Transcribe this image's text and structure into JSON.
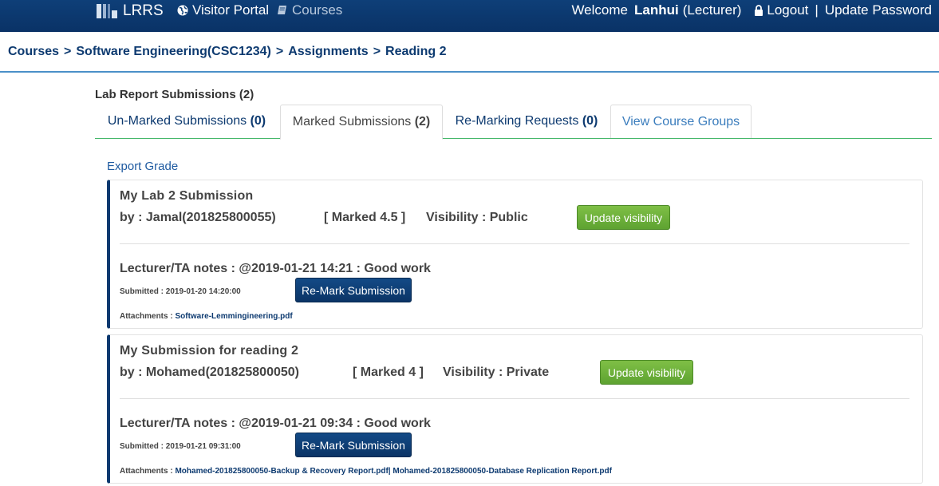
{
  "nav": {
    "brand": "LRRS",
    "visitor_portal": "Visitor Portal",
    "courses": "Courses",
    "welcome": "Welcome",
    "user_name": "Lanhui",
    "user_role": "(Lecturer)",
    "logout": "Logout",
    "separator": "|",
    "update_password": "Update Password"
  },
  "breadcrumb": {
    "items": [
      "Courses",
      "Software Engineering(CSC1234)",
      "Assignments",
      "Reading 2"
    ],
    "separator": ">"
  },
  "section_title": "Lab Report Submissions (2)",
  "tabs": [
    {
      "label": "Un-Marked Submissions",
      "count": "(0)"
    },
    {
      "label": "Marked Submissions",
      "count": "(2)"
    },
    {
      "label": "Re-Marking Requests",
      "count": "(0)"
    },
    {
      "label": "View Course Groups",
      "count": ""
    }
  ],
  "export_grade": "Export Grade",
  "submissions": [
    {
      "title": "My Lab 2 Submission",
      "by": "by : Jamal(201825800055)",
      "marked": "[ Marked 4.5 ]",
      "visibility": "Visibility : Public",
      "update_visibility": "Update visibility",
      "notes": "Lecturer/TA notes : @2019-01-21 14:21 : Good work",
      "submitted": "Submitted : 2019-01-20 14:20:00",
      "remark": "Re-Mark Submission",
      "attachments_label": "Attachments :",
      "attachments": "Software-Lemmingineering.pdf"
    },
    {
      "title": "My Submission for reading 2",
      "by": "by : Mohamed(201825800050)",
      "marked": "[ Marked 4 ]",
      "visibility": "Visibility : Private",
      "update_visibility": "Update visibility",
      "notes": "Lecturer/TA notes : @2019-01-21 09:34 : Good work",
      "submitted": "Submitted : 2019-01-21 09:31:00",
      "remark": "Re-Mark Submission",
      "attachments_label": "Attachments :",
      "attachments": "Mohamed-201825800050-Backup & Recovery Report.pdf| Mohamed-201825800050-Database Replication Report.pdf"
    }
  ],
  "colors": {
    "navbar": "#0e3f78",
    "accent_navy": "#0d3a70",
    "button_green": "#6bb13a",
    "tab_rule": "#45b86a",
    "crumb_rule": "#4a90c8"
  }
}
